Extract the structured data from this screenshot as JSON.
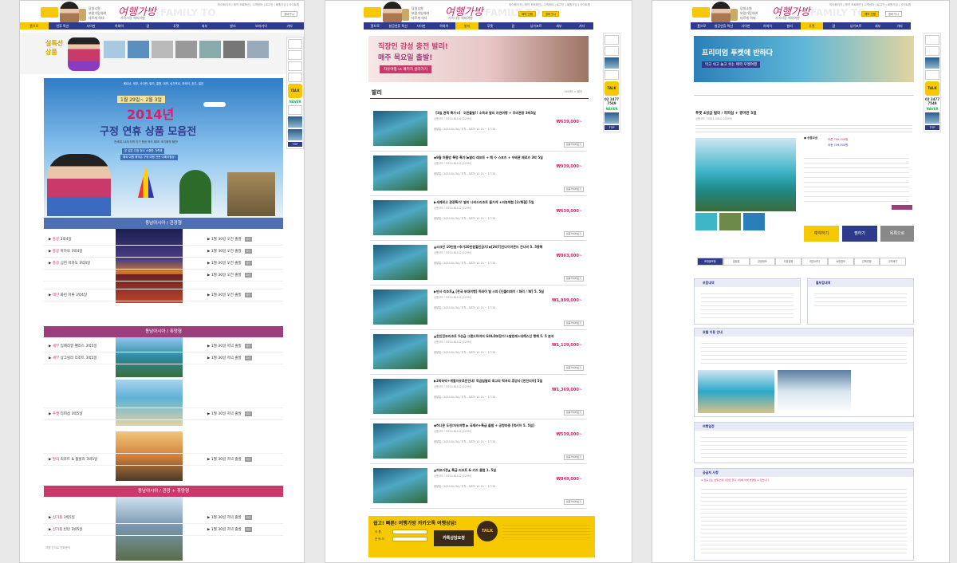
{
  "header": {
    "taglines": [
      "당일소원",
      "보람가입하여",
      "다르게 하다"
    ],
    "brand": "여행가방",
    "brand_sub": "가족사랑 해외여행",
    "ghost": "FAMILY TO",
    "top_links": "마이페이지 | 예약 조회확인 | 고객센터 | 로그인 | 회원가입 | 사이트맵",
    "btn_reservation": "예약 진행",
    "btn_cart": "장바구니"
  },
  "nav": [
    "홈으로",
    "연휴 특선",
    "사이판",
    "하와이",
    "괌",
    "푸켓",
    "세부",
    "발리",
    "보라카이",
    "기타"
  ],
  "nav2": [
    "홈으로",
    "항공연휴 특선",
    "사이판",
    "하와이",
    "발리",
    "푸켓",
    "괌",
    "싱가포르",
    "세부",
    "기타"
  ],
  "panel1": {
    "hero_title": "설특선 상품",
    "mini_items": [
      "",
      "",
      "",
      "",
      "",
      "",
      ""
    ],
    "banner_top": "베트남, 세부, 사이판, 발리, 홍콩, 대만, 싱가포르, 하와이, 호주, 일본",
    "banner_dates": "1월 29일~ 2월 3일",
    "banner_year": "2014년",
    "banner_headline": "구정 연휴 상품 모음전",
    "banner_desc": "전세계 14개 지역 인기 항공 좌석 확보! 조기예약 할인!",
    "banner_note1": "온 김은 다양 장수 소중한 가족과",
    "banner_note2": "해외 여행 예약은 구매 여행 전문 이베이항공!",
    "sections": [
      {
        "title": "동남아시아 / 관광형",
        "color": "#4f6fb3",
        "rows": [
          {
            "dest": "홍콩",
            "name": "3박4일",
            "date": "1월 30일 오전 출발"
          },
          {
            "dest": "홍콩",
            "name": "마카오 3박4일",
            "date": "1월 30일 오전 출발"
          },
          {
            "dest": "홍콩",
            "name": "심천 마카오 3박4일",
            "date": "1월 30일 오전 출발"
          },
          {
            "dest": "",
            "name": "",
            "date": "1월 30일 오전 출발"
          },
          {
            "dest": "",
            "name": "",
            "date": ""
          },
          {
            "dest": "대만",
            "name": "화련 아류 3박4일",
            "date": "1월 30일 오전 출발"
          }
        ]
      },
      {
        "title": "동남아시아 / 휴양형",
        "color": "#9b3f7c",
        "rows": [
          {
            "dest": "세부",
            "name": "임페리얼 팰리스 3박5일",
            "date": "1월 30일 저녁 출발"
          },
          {
            "dest": "세부",
            "name": "샹그릴라 리조트 3박5일",
            "date": "1월 30일 저녁 출발"
          },
          {
            "dest": "",
            "name": "",
            "date": ""
          },
          {
            "dest": "푸켓",
            "name": "티피섬 3박5일",
            "date": "1월 30일 저녁 출발"
          },
          {
            "dest": "",
            "name": "",
            "date": ""
          },
          {
            "dest": "발리",
            "name": "리조트 & 풀빌라 3박5일",
            "date": "1월 30일 저녁 출발"
          }
        ]
      },
      {
        "title": "동남아시아 / 관광 + 휴양형",
        "color": "#c93a6a",
        "rows": [
          {
            "dest": "싱가폴",
            "name": "3박5일",
            "date": "1월 30일 저녁 출발"
          },
          {
            "dest": "싱가폴",
            "name": "빈탄 3박5일",
            "date": "1월 30일 저녁 출발"
          }
        ]
      }
    ],
    "go": "GO",
    "footer": "여행 간자료 전화문의 "
  },
  "panel2": {
    "banner_line1": "직장인 감성 충전 발리!",
    "banner_line2": "매주 목요일 출발!",
    "banner_button": "자유여행 vs 패키지 골라가기",
    "section_title": "발리",
    "breadcrumb": "HOME > 발리",
    "items": [
      {
        "title": "【3일 관찍 특가★】 오픈출발!! 소득과 발리 자연여행 + 무비관광 3박5일",
        "sub": "상품코드 : BP10-BL0-6 [02PM]",
        "price": "₩639,000~"
      },
      {
        "title": "◆9월 여름방 특명 특가!◆발리 레프트 + 해 수 스포츠 + 우베관 제로즈 3박 5일",
        "sub": "상품코드 : BP10-BL0-0 [02PM]",
        "price": "₩939,000~"
      },
      {
        "title": "▶세계최고 관광특가! 발리 나비드리조트 즐거게 ★리뷰체험 [오/해결] 5일",
        "sub": "상품코드 : BP10-BL0-0 [02PM]",
        "price": "₩639,000~"
      },
      {
        "title": "▲씨크빈 10만원+추가20만원할인금지!◆[2박7]인다이아몬드 잔나비 5. 5종해",
        "sub": "상품코드 : BP10-BL0-0 [02PM]",
        "price": "₩863,000~"
      },
      {
        "title": "▶반사 리조트▲ [한국 부대여행] 하와이 빌 스파 [인플러레이 / 화려 / W] 5. 5일",
        "sub": "상품코드 : BP10-BL0-0 [02PM]",
        "price": "₩1,899,000~"
      },
      {
        "title": "▲한인전부리조트 5성급 그랜드하여저 GOLD보장가!+발판레+대해스인 행해 5. 5 분석",
        "sub": "상품코드 : BP10-BL0-0 [02PM]",
        "price": "₩1,129,000~"
      },
      {
        "title": "▶2박숙박+계절자유로운안내! 적금일발리 최고의 럭셔리 휴양사 [반딘리아] 5일",
        "sub": "상품코드 : BP10-BL0-0 [02PM]",
        "price": "₩1,369,000~"
      },
      {
        "title": "◆허니문 도전/자유여행 ▶ 국제카+특급 출발 + 공항마중 [럭키어 5. 5일]",
        "sub": "상품코드 : BP10-BL0-0 [02PM]",
        "price": "₩539,000~"
      },
      {
        "title": "▲허프가정▲ 특급 리조트 & 키즈 클럽 1. 5일",
        "sub": "상품코드 : BP10-BL0-0 [02PM]",
        "price": "₩849,000~"
      }
    ],
    "item_meta": "출발일 : 2014.01.30 / 도착 : GATY 11:25 ~ 17:35",
    "item_button": "상품자세히보기",
    "kakao_title": "쉽고! 빠른! 여행가방 카카오톡 여행상담!",
    "kakao_button": "카톡상담요청",
    "kakao_label_name": "이 름",
    "kakao_label_phone": "연 락 처"
  },
  "panel3": {
    "banner_line1": "프리미엄 푸켓에 반하다",
    "banner_line2": "먹고 쉬고 놀고 쉬는 매력 푸켓여행",
    "title": "푸켓 4성급 빌라 / 피피섬 + 팡아만 5일",
    "code": "상품코드 : BP11-U6L0-022PM",
    "price_label": "● 상품요금",
    "price1": "어른 799,000원",
    "price2": "아동 759,000원",
    "btn_reserve": "예약하기",
    "btn_consult": "찜하기",
    "btn_list": "목록으로",
    "tabs": [
      "포함불포함",
      "일정표",
      "관광정보",
      "자유일정",
      "여권/비자",
      "쇼핑정보",
      "선택관광",
      "고객후기"
    ],
    "box1_title": "포함내역",
    "box2_title": "불포함내역",
    "box3_title": "호텔 이용 안내",
    "box4_title": "여행일정",
    "box5_title": "공급처 사항",
    "notice": "※ 항공 또는 호텔 안내 사항은 현지 사정에 의해 변경될 수 있습니다."
  }
}
